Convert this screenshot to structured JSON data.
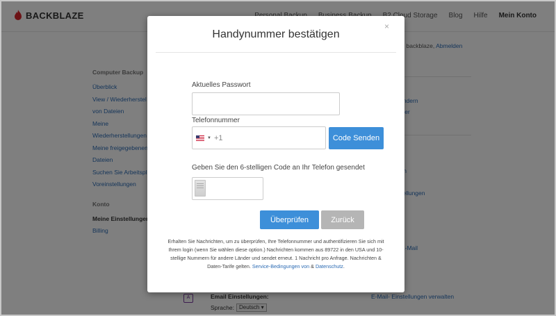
{
  "brand": {
    "name": "BACKBLAZE"
  },
  "nav": {
    "items": [
      "Personal Backup",
      "Business Backup",
      "B2 Cloud Storage",
      "Blog",
      "Hilfe"
    ],
    "account": "Mein Konto"
  },
  "header_text": {
    "prefix": "nen backblaze,",
    "logout": "Abmelden"
  },
  "sidebar": {
    "section1": "Computer Backup",
    "items1": [
      "Überblick",
      "View / Wiederherstel",
      "von Dateien",
      "Meine",
      "Wiederherstellungen",
      "Meine freigegebenen",
      "Dateien",
      "Suchen Sie Arbeitspl",
      "Voreinstellungen"
    ],
    "section2": "Konto",
    "items2": [
      "Meine Einstellungen",
      "Billing"
    ]
  },
  "right_links": [
    "e ändern",
    "mmer",
    "en",
    "dern",
    "nstellungen",
    "ie E-Mail"
  ],
  "email_section": {
    "heading": "Email Einstellungen:",
    "language_label": "Sprache:",
    "language_value": "Deutsch",
    "manage_link": "E-Mail- Einstellungen verwalten"
  },
  "modal": {
    "title": "Handynummer bestätigen",
    "close": "×",
    "password_label": "Aktuelles Passwort",
    "phone_label": "Telefonnummer",
    "phone_prefix": "+1",
    "send_button": "Code Senden",
    "code_label": "Geben Sie den 6-stelligen Code an Ihr Telefon gesendet",
    "verify_button": "Überprüfen",
    "back_button": "Zurück",
    "fine_print": "Erhalten Sie Nachrichten, um zu überprüfen, Ihre Telefonnummer und authentifizieren Sie sich mit Ihrem login (wenn Sie wählen diese option.) Nachrichten kommen aus 89722 in den USA und 10-stellige Nummern für andere Länder und sendet erneut. 1 Nachricht pro Anfrage. Nachrichten & Daten-Tarife gelten.",
    "terms_link": "Service-Bedingungen von",
    "amp": "&",
    "privacy_link": "Datenschutz",
    "period": "."
  },
  "colors": {
    "primary": "#3d8fd9",
    "disabled": "#b5b5b5",
    "link": "#2a6ab3",
    "brand": "#d9262c"
  }
}
